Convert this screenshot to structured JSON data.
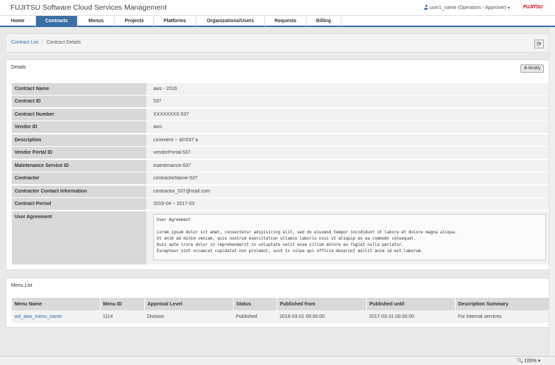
{
  "header": {
    "app_title": "FUJITSU Software Cloud Services Management",
    "user_label": "user1_name (Operators - Approver)",
    "logo_text": "FUJITSU"
  },
  "nav": {
    "tabs": [
      {
        "label": "Home",
        "active": false
      },
      {
        "label": "Contracts",
        "active": true
      },
      {
        "label": "Menus",
        "active": false
      },
      {
        "label": "Projects",
        "active": false
      },
      {
        "label": "Platforms",
        "active": false
      },
      {
        "label": "Organizations/Users",
        "active": false
      },
      {
        "label": "Requests",
        "active": false
      },
      {
        "label": "Billing",
        "active": false
      }
    ]
  },
  "breadcrumb": {
    "link": "Contract List",
    "separator": "/",
    "current": "Contract Details"
  },
  "details": {
    "title": "Details",
    "modify_label": "Modify",
    "rows": [
      {
        "label": "Contract Name",
        "value": "aws - 2016"
      },
      {
        "label": "Contract ID",
        "value": "537"
      },
      {
        "label": "Contract Number",
        "value": "XXXXXXXX-537"
      },
      {
        "label": "Vendor ID",
        "value": "aws"
      },
      {
        "label": "Description",
        "value": "comment -- id=537 a"
      },
      {
        "label": "Vendor Portal ID",
        "value": "vendorPortal-537"
      },
      {
        "label": "Maintenance Service ID",
        "value": "maintenance-537"
      },
      {
        "label": "Contractor",
        "value": "contractorName-537"
      },
      {
        "label": "Contractor Contact Information",
        "value": "contractor_537@mail.com"
      },
      {
        "label": "Contract Period",
        "value": "2016-04 ~ 2017-03"
      }
    ],
    "agreement_label": "User Agreement",
    "agreement_text": "User Agreement\n\nLorem ipsum dolor sit amet, consectetur adipisicing elit, sed do eiusmod tempor incididunt ut labore et dolore magna aliqua.\nUt enim ad minim veniam, quis nostrud exercitation ullamco laboris nisi ut aliquip ex ea commodo consequat.\nDuis aute irure dolor in reprehenderit in voluptate velit esse cillum dolore eu fugiat nulla pariatur.\nExcepteur sint occaecat cupidatat non proident, sunt in culpa qui officia deserunt mollit anim id est laborum."
  },
  "menu_list": {
    "title": "Menu List",
    "columns": [
      "Menu Name",
      "Menu ID",
      "Approval Level",
      "Status",
      "Published from",
      "Published until",
      "Description Summary"
    ],
    "rows": [
      [
        "wd_aws_menu_name",
        "1114",
        "Division",
        "Published",
        "2016-03-01 00:00:00",
        "2017-03-31 00:00:00",
        "For internal services"
      ]
    ]
  },
  "statusbar": {
    "zoom": "100%"
  }
}
